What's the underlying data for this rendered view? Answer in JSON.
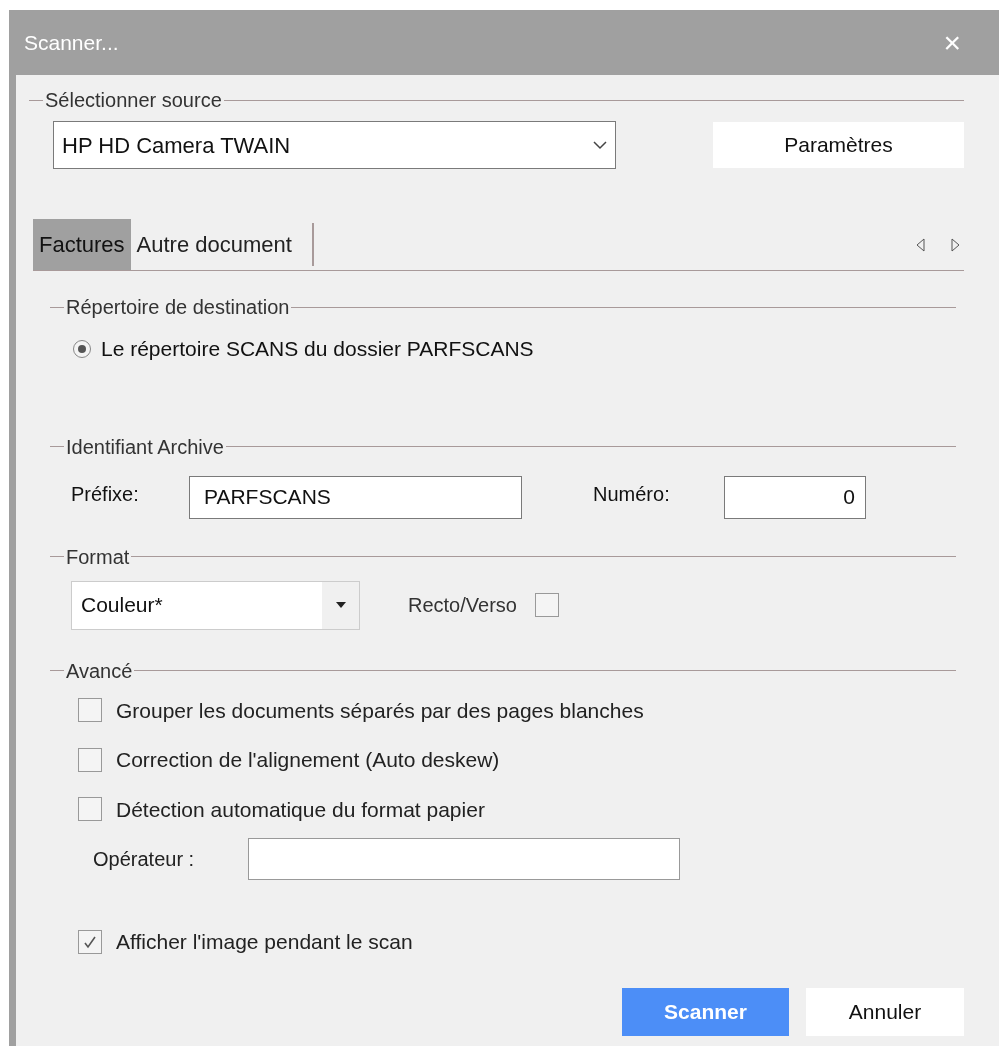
{
  "window": {
    "title": "Scanner...",
    "close": "×"
  },
  "source": {
    "label": "Sélectionner source",
    "value": "HP HD Camera TWAIN",
    "settings_button": "Paramètres"
  },
  "tabs": [
    {
      "label": "Factures",
      "selected": true
    },
    {
      "label": "Autre document",
      "selected": false
    }
  ],
  "destination": {
    "label": "Répertoire de destination",
    "options": [
      {
        "label": "Le répertoire SCANS du dossier PARFSCANS",
        "selected": true
      }
    ]
  },
  "archive": {
    "label": "Identifiant Archive",
    "prefix_label": "Préfixe:",
    "prefix_value": "PARFSCANS",
    "number_label": "Numéro:",
    "number_value": "0"
  },
  "format": {
    "label": "Format",
    "value": "Couleur*",
    "duplex_label": "Recto/Verso",
    "duplex_checked": false
  },
  "advanced": {
    "label": "Avancé",
    "options": [
      {
        "label": "Grouper les documents séparés par des pages blanches",
        "checked": false
      },
      {
        "label": "Correction de l'alignement (Auto deskew)",
        "checked": false
      },
      {
        "label": "Détection automatique du format papier",
        "checked": false
      }
    ],
    "operator_label": "Opérateur :"
  },
  "show_image": {
    "label": "Afficher l'image pendant le scan",
    "checked": true
  },
  "buttons": [
    {
      "label": "Scanner",
      "kind": "primary"
    },
    {
      "label": "Annuler",
      "kind": "secondary"
    }
  ]
}
